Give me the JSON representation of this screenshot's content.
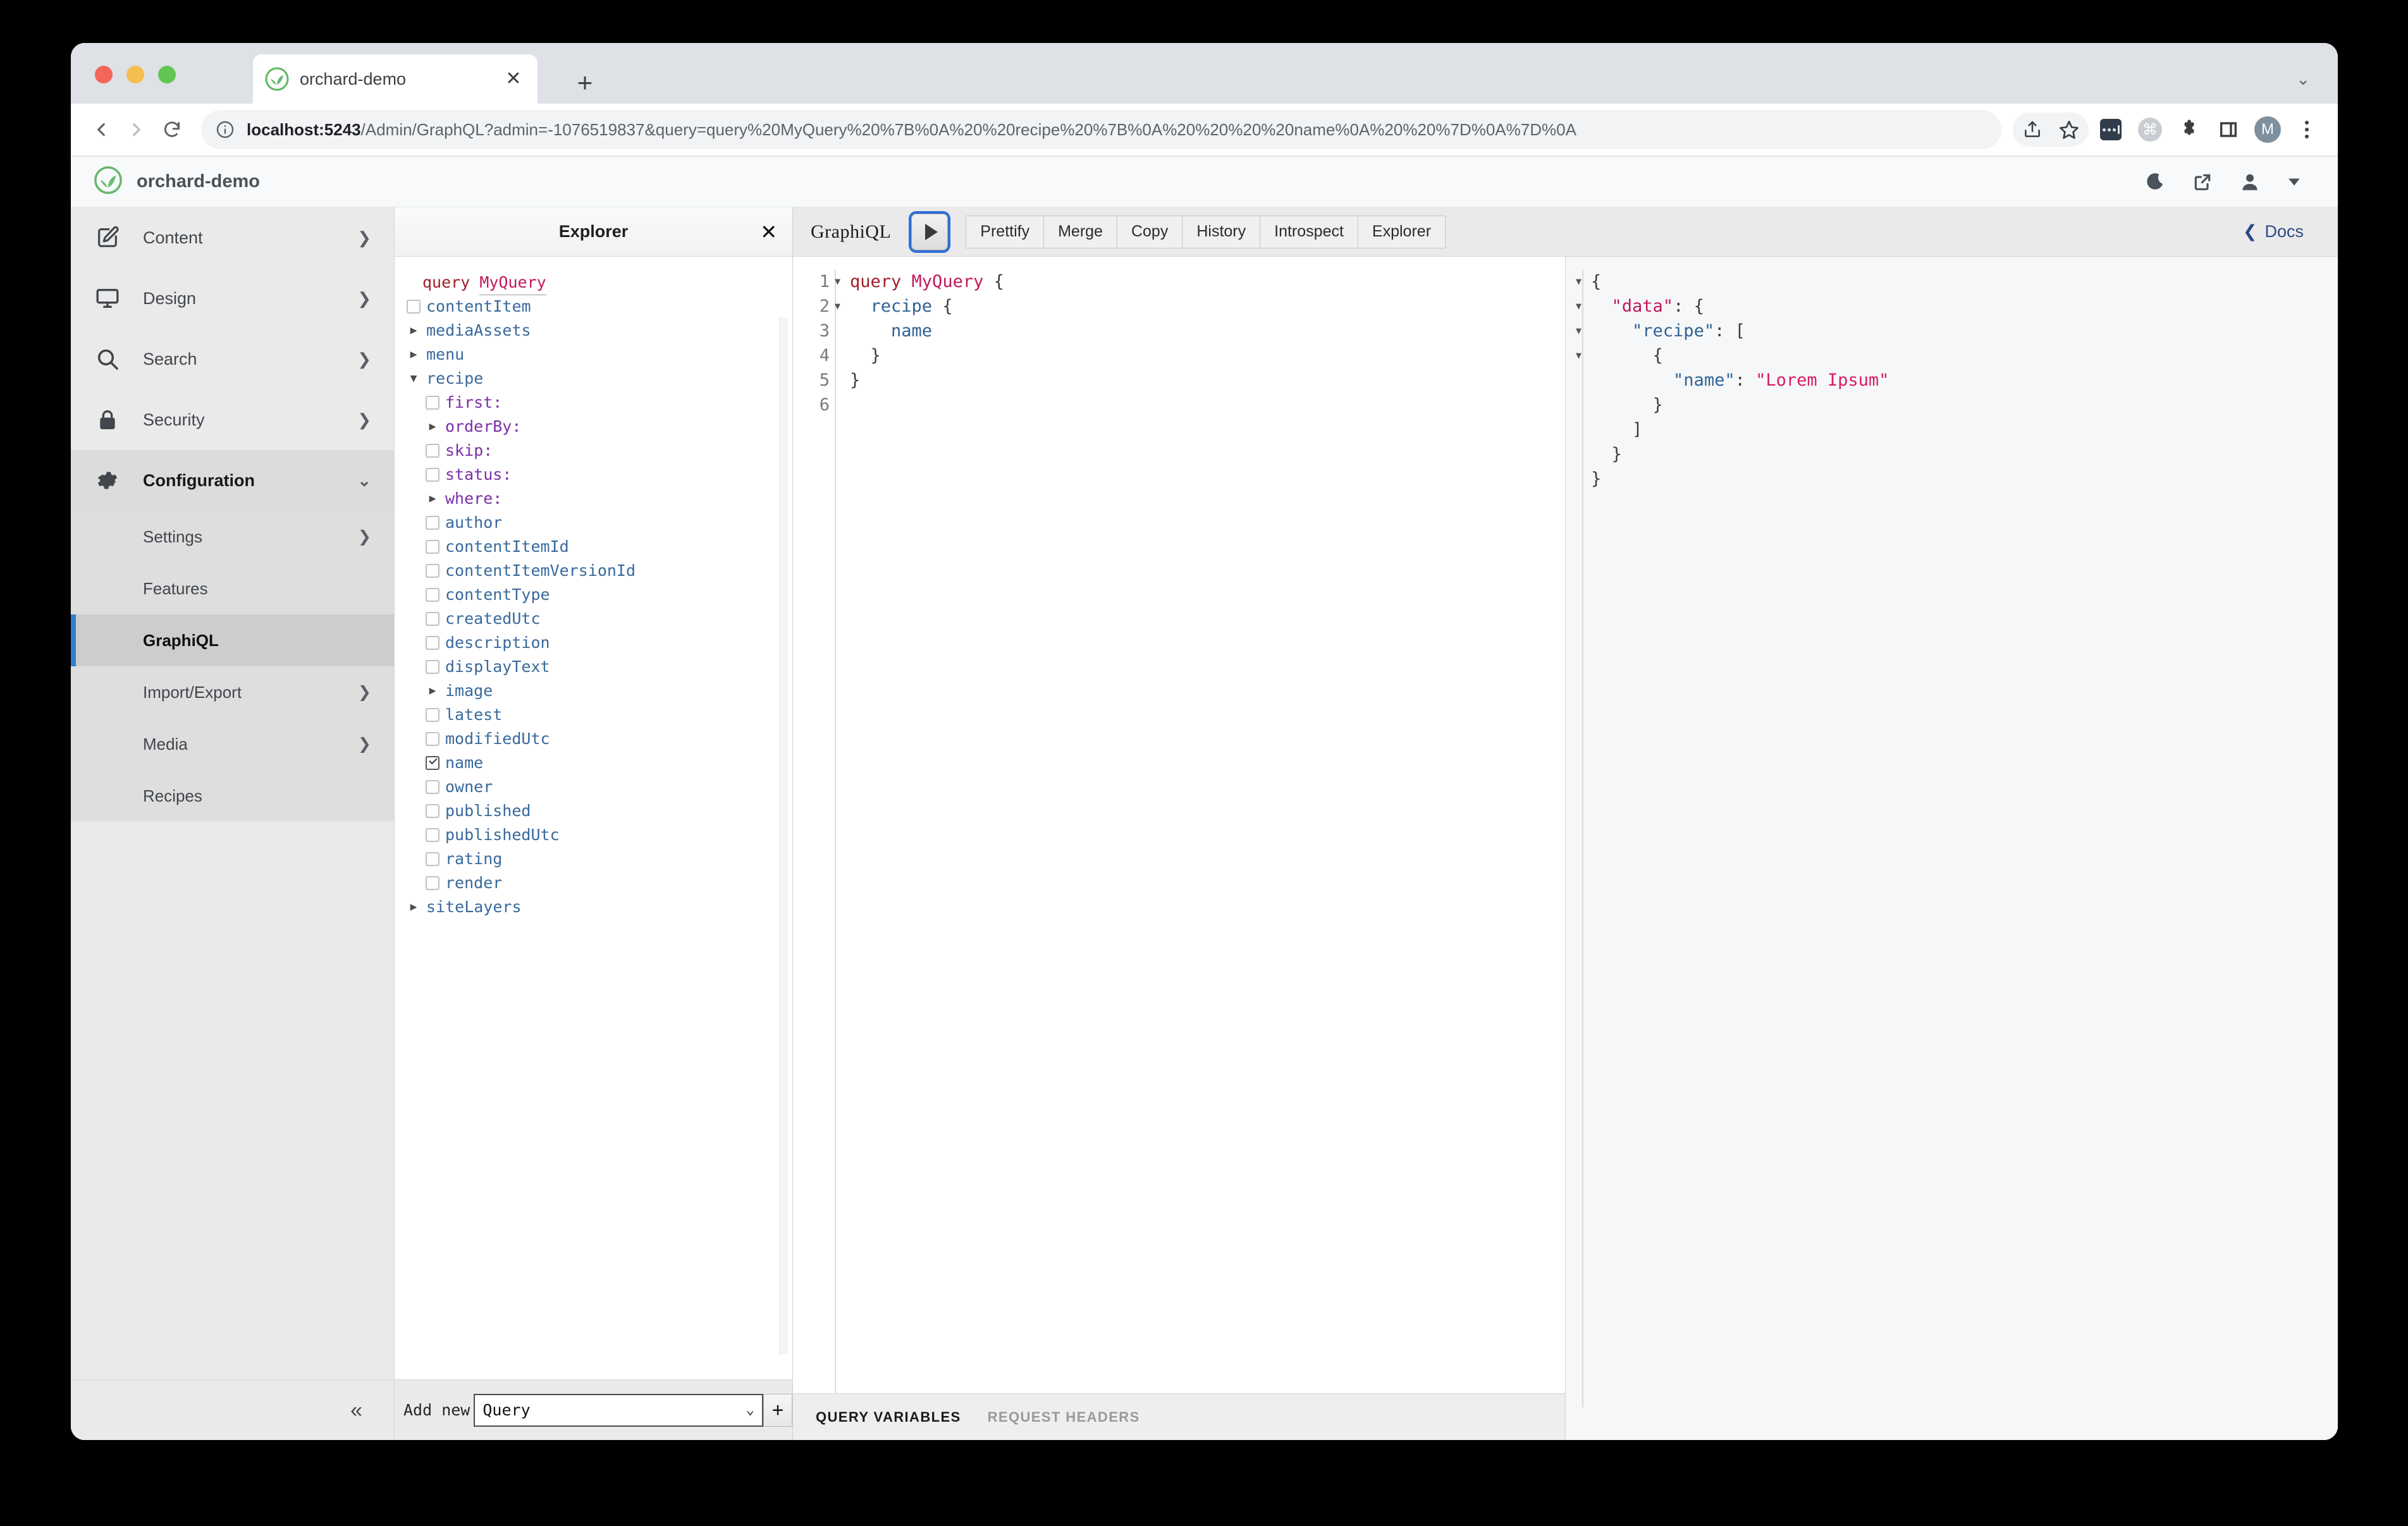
{
  "browser": {
    "tab": {
      "title": "orchard-demo",
      "favicon": "orchard-leaf-icon",
      "close": "✕"
    },
    "new_tab": "+",
    "tabstrip_chevron": "⌄",
    "omnibox": {
      "info_icon": "info-icon",
      "url_host": "localhost:5243",
      "url_rest": "/Admin/GraphQL?admin=-1076519837&query=query%20MyQuery%20%7B%0A%20%20recipe%20%7B%0A%20%20%20%20name%0A%20%20%7D%0A%7D%0A"
    },
    "toolbar_icons": [
      "share-icon",
      "star-icon",
      "extension-dark-icon",
      "command-icon",
      "puzzle-icon",
      "sidebar-icon",
      "profile-avatar",
      "kebab-menu-icon"
    ],
    "profile_initial": "M",
    "nav_icons": [
      "back-icon",
      "forward-icon",
      "reload-icon"
    ]
  },
  "app_header": {
    "brand_name": "orchard-demo",
    "logo": "orchard-leaf-logo",
    "right_icons": [
      "moon-icon",
      "external-link-icon",
      "user-icon",
      "chevron-down-icon"
    ]
  },
  "sidebar": {
    "items": [
      {
        "label": "Content",
        "icon": "pencil-square-icon",
        "chevron": "❯",
        "active": false
      },
      {
        "label": "Design",
        "icon": "monitor-icon",
        "chevron": "❯",
        "active": false
      },
      {
        "label": "Search",
        "icon": "magnifier-icon",
        "chevron": "❯",
        "active": false
      },
      {
        "label": "Security",
        "icon": "lock-icon",
        "chevron": "❯",
        "active": false
      },
      {
        "label": "Configuration",
        "icon": "gear-icon",
        "chevron": "⌄",
        "active": true
      }
    ],
    "sub_items": [
      {
        "label": "Settings",
        "chevron": "❯",
        "active": false
      },
      {
        "label": "Features",
        "chevron": "",
        "active": false
      },
      {
        "label": "GraphiQL",
        "chevron": "",
        "active": true
      },
      {
        "label": "Import/Export",
        "chevron": "❯",
        "active": false
      },
      {
        "label": "Media",
        "chevron": "❯",
        "active": false
      },
      {
        "label": "Recipes",
        "chevron": "",
        "active": false
      }
    ],
    "collapse_icon": "«"
  },
  "explorer": {
    "title": "Explorer",
    "close_icon": "✕",
    "operation": {
      "keyword": "query",
      "name": "MyQuery"
    },
    "tree": [
      {
        "label": "contentItem",
        "kind": "field",
        "control": "checkbox",
        "checked": false,
        "indent": 0
      },
      {
        "label": "mediaAssets",
        "kind": "field",
        "control": "triangle-right",
        "indent": 0
      },
      {
        "label": "menu",
        "kind": "field",
        "control": "triangle-right",
        "indent": 0
      },
      {
        "label": "recipe",
        "kind": "field",
        "control": "triangle-down",
        "indent": 0
      },
      {
        "label": "first:",
        "kind": "arg",
        "control": "checkbox",
        "checked": false,
        "indent": 1
      },
      {
        "label": "orderBy:",
        "kind": "arg",
        "control": "triangle-right",
        "indent": 1
      },
      {
        "label": "skip:",
        "kind": "arg",
        "control": "checkbox",
        "checked": false,
        "indent": 1
      },
      {
        "label": "status:",
        "kind": "arg",
        "control": "checkbox",
        "checked": false,
        "indent": 1
      },
      {
        "label": "where:",
        "kind": "arg",
        "control": "triangle-right",
        "indent": 1
      },
      {
        "label": "author",
        "kind": "field",
        "control": "checkbox",
        "checked": false,
        "indent": 1
      },
      {
        "label": "contentItemId",
        "kind": "field",
        "control": "checkbox",
        "checked": false,
        "indent": 1
      },
      {
        "label": "contentItemVersionId",
        "kind": "field",
        "control": "checkbox",
        "checked": false,
        "indent": 1
      },
      {
        "label": "contentType",
        "kind": "field",
        "control": "checkbox",
        "checked": false,
        "indent": 1
      },
      {
        "label": "createdUtc",
        "kind": "field",
        "control": "checkbox",
        "checked": false,
        "indent": 1
      },
      {
        "label": "description",
        "kind": "field",
        "control": "checkbox",
        "checked": false,
        "indent": 1
      },
      {
        "label": "displayText",
        "kind": "field",
        "control": "checkbox",
        "checked": false,
        "indent": 1
      },
      {
        "label": "image",
        "kind": "field",
        "control": "triangle-right",
        "indent": 1
      },
      {
        "label": "latest",
        "kind": "field",
        "control": "checkbox",
        "checked": false,
        "indent": 1
      },
      {
        "label": "modifiedUtc",
        "kind": "field",
        "control": "checkbox",
        "checked": false,
        "indent": 1
      },
      {
        "label": "name",
        "kind": "field",
        "control": "checkbox",
        "checked": true,
        "indent": 1
      },
      {
        "label": "owner",
        "kind": "field",
        "control": "checkbox",
        "checked": false,
        "indent": 1
      },
      {
        "label": "published",
        "kind": "field",
        "control": "checkbox",
        "checked": false,
        "indent": 1
      },
      {
        "label": "publishedUtc",
        "kind": "field",
        "control": "checkbox",
        "checked": false,
        "indent": 1
      },
      {
        "label": "rating",
        "kind": "field",
        "control": "checkbox",
        "checked": false,
        "indent": 1
      },
      {
        "label": "render",
        "kind": "field",
        "control": "checkbox",
        "checked": false,
        "indent": 1
      },
      {
        "label": "siteLayers",
        "kind": "field",
        "control": "triangle-right",
        "indent": 0
      }
    ],
    "footer": {
      "add_new_label": "Add new",
      "select_value": "Query",
      "select_chevron": "⌄",
      "add_button": "+"
    }
  },
  "graphiql": {
    "logo": "GraphiQL",
    "execute_button": "execute-query-button",
    "buttons": [
      "Prettify",
      "Merge",
      "Copy",
      "History",
      "Introspect",
      "Explorer"
    ],
    "docs_label": "Docs",
    "docs_chevron": "❮",
    "query_editor": {
      "line_numbers": [
        "1",
        "2",
        "3",
        "4",
        "5",
        "6"
      ],
      "folds": [
        true,
        true,
        false,
        false,
        false,
        false
      ],
      "lines": [
        [
          {
            "t": "query ",
            "c": "kw"
          },
          {
            "t": "MyQuery",
            "c": "op"
          },
          {
            "t": " {",
            "c": "pun"
          }
        ],
        [
          {
            "t": "  ",
            "c": "pun"
          },
          {
            "t": "recipe",
            "c": "fld"
          },
          {
            "t": " {",
            "c": "pun"
          }
        ],
        [
          {
            "t": "    ",
            "c": "pun"
          },
          {
            "t": "name",
            "c": "fld"
          }
        ],
        [
          {
            "t": "  }",
            "c": "pun"
          }
        ],
        [
          {
            "t": "}",
            "c": "pun"
          }
        ],
        [
          {
            "t": "",
            "c": "pun"
          }
        ]
      ]
    },
    "variables_tabs": [
      {
        "label": "QUERY VARIABLES",
        "active": true
      },
      {
        "label": "REQUEST HEADERS",
        "active": false
      }
    ],
    "result": {
      "folds": [
        true,
        true,
        true,
        true,
        false,
        false,
        false,
        false,
        false
      ],
      "lines": [
        [
          {
            "t": "{",
            "c": "pun"
          }
        ],
        [
          {
            "t": "  ",
            "c": "pun"
          },
          {
            "t": "\"data\"",
            "c": "datakey"
          },
          {
            "t": ": {",
            "c": "pun"
          }
        ],
        [
          {
            "t": "    ",
            "c": "pun"
          },
          {
            "t": "\"recipe\"",
            "c": "key"
          },
          {
            "t": ": [",
            "c": "pun"
          }
        ],
        [
          {
            "t": "      {",
            "c": "pun"
          }
        ],
        [
          {
            "t": "        ",
            "c": "pun"
          },
          {
            "t": "\"name\"",
            "c": "key"
          },
          {
            "t": ": ",
            "c": "pun"
          },
          {
            "t": "\"Lorem Ipsum\"",
            "c": "str"
          }
        ],
        [
          {
            "t": "      }",
            "c": "pun"
          }
        ],
        [
          {
            "t": "    ]",
            "c": "pun"
          }
        ],
        [
          {
            "t": "  }",
            "c": "pun"
          }
        ],
        [
          {
            "t": "}",
            "c": "pun"
          }
        ]
      ]
    }
  },
  "colors": {
    "accent_blue": "#2f7fd1",
    "brand_green": "#64b767",
    "keyword_red": "#a11f2b",
    "opname_pink": "#c2185b",
    "field_blue": "#39699c",
    "arg_purple": "#7b2fa8",
    "string_pink": "#d81b60",
    "docs_navy": "#2b4a86",
    "sidebar_bg": "#eaeaea"
  }
}
